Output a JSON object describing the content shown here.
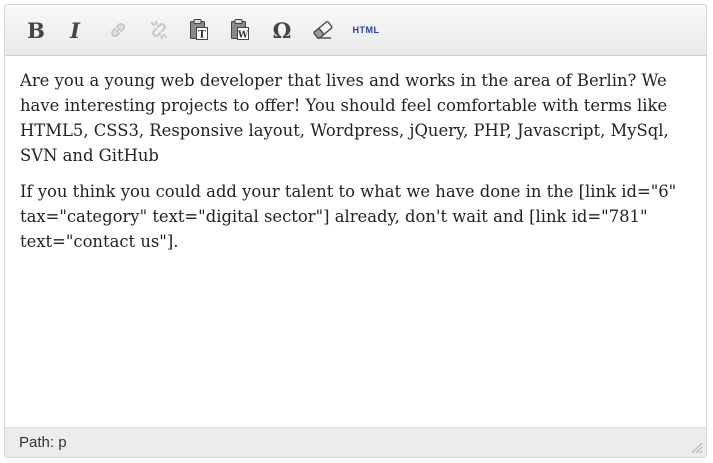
{
  "toolbar": {
    "buttons": [
      {
        "name": "bold",
        "glyph": "B"
      },
      {
        "name": "italic",
        "glyph": "I"
      },
      {
        "name": "insert-link",
        "icon": "link-icon"
      },
      {
        "name": "unlink",
        "icon": "unlink-icon"
      },
      {
        "name": "paste-text",
        "icon": "paste-text-icon"
      },
      {
        "name": "paste-word",
        "icon": "paste-word-icon"
      },
      {
        "name": "special-character",
        "glyph": "Ω"
      },
      {
        "name": "remove-format",
        "icon": "eraser-icon"
      },
      {
        "name": "html",
        "label": "HTML"
      }
    ],
    "bold_label": "B",
    "italic_label": "I",
    "omega_label": "Ω",
    "html_label": "HTML",
    "html_color": "#2443a8",
    "disabled_color": "#c8c8c8"
  },
  "content": {
    "paragraph_1": "Are you a young web developer that lives and works in the area of Berlin? We have interesting projects to offer! You should feel comfortable with terms like HTML5, CSS3, Responsive layout, Wordpress, jQuery, PHP, Javascript, MySql, SVN and GitHub",
    "paragraph_2": "If you think you could add your talent to what we have done in the [link id=\"6\" tax=\"category\" text=\"digital sector\"] already, don't wait and [link id=\"781\" text=\"contact us\"]."
  },
  "statusbar": {
    "path_label": "Path:",
    "path_value": "p"
  }
}
